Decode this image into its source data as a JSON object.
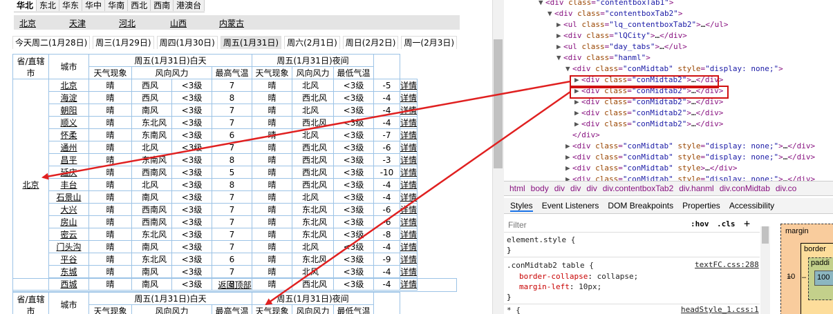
{
  "weather": {
    "region_tabs": [
      "华北",
      "东北",
      "华东",
      "华中",
      "华南",
      "西北",
      "西南",
      "港澳台"
    ],
    "provinces": [
      "北京",
      "天津",
      "河北",
      "山西",
      "内蒙古"
    ],
    "day_tabs": [
      "今天周二(1月28日)",
      "周三(1月29日)",
      "周四(1月30日)",
      "周五(1月31日)",
      "周六(2月1日)",
      "周日(2月2日)",
      "周一(2月3日)"
    ],
    "active_day": 3,
    "header": {
      "prov_col": "省/直辖市",
      "prov_col_line1": "省/直辖",
      "prov_col_line2": "市",
      "city_col": "城市",
      "day_group": "周五(1月31日)白天",
      "night_group": "周五(1月31日)夜间",
      "weather": "天气现象",
      "wind": "风向风力",
      "high": "最高气温",
      "low": "最低气温"
    },
    "province_name": "北京",
    "rows": [
      {
        "city": "北京",
        "dw": "晴",
        "dwd": "西风",
        "dwf": "<3级",
        "hi": "7",
        "nw": "晴",
        "nwd": "北风",
        "nwf": "<3级",
        "lo": "-5",
        "link": "详情"
      },
      {
        "city": "海淀",
        "dw": "晴",
        "dwd": "西风",
        "dwf": "<3级",
        "hi": "8",
        "nw": "晴",
        "nwd": "西北风",
        "nwf": "<3级",
        "lo": "-4",
        "link": "详情"
      },
      {
        "city": "朝阳",
        "dw": "晴",
        "dwd": "南风",
        "dwf": "<3级",
        "hi": "7",
        "nw": "晴",
        "nwd": "北风",
        "nwf": "<3级",
        "lo": "-4",
        "link": "详情"
      },
      {
        "city": "顺义",
        "dw": "晴",
        "dwd": "东北风",
        "dwf": "<3级",
        "hi": "7",
        "nw": "晴",
        "nwd": "西北风",
        "nwf": "<3级",
        "lo": "-4",
        "link": "详情"
      },
      {
        "city": "怀柔",
        "dw": "晴",
        "dwd": "东南风",
        "dwf": "<3级",
        "hi": "6",
        "nw": "晴",
        "nwd": "北风",
        "nwf": "<3级",
        "lo": "-7",
        "link": "详情"
      },
      {
        "city": "通州",
        "dw": "晴",
        "dwd": "北风",
        "dwf": "<3级",
        "hi": "7",
        "nw": "晴",
        "nwd": "西北风",
        "nwf": "<3级",
        "lo": "-6",
        "link": "详情"
      },
      {
        "city": "昌平",
        "dw": "晴",
        "dwd": "东南风",
        "dwf": "<3级",
        "hi": "8",
        "nw": "晴",
        "nwd": "西北风",
        "nwf": "<3级",
        "lo": "-3",
        "link": "详情"
      },
      {
        "city": "延庆",
        "dw": "晴",
        "dwd": "西南风",
        "dwf": "<3级",
        "hi": "5",
        "nw": "晴",
        "nwd": "西北风",
        "nwf": "<3级",
        "lo": "-10",
        "link": "详情"
      },
      {
        "city": "丰台",
        "dw": "晴",
        "dwd": "北风",
        "dwf": "<3级",
        "hi": "8",
        "nw": "晴",
        "nwd": "西北风",
        "nwf": "<3级",
        "lo": "-4",
        "link": "详情"
      },
      {
        "city": "石景山",
        "dw": "晴",
        "dwd": "南风",
        "dwf": "<3级",
        "hi": "7",
        "nw": "晴",
        "nwd": "北风",
        "nwf": "<3级",
        "lo": "-4",
        "link": "详情"
      },
      {
        "city": "大兴",
        "dw": "晴",
        "dwd": "西南风",
        "dwf": "<3级",
        "hi": "7",
        "nw": "晴",
        "nwd": "东北风",
        "nwf": "<3级",
        "lo": "-6",
        "link": "详情"
      },
      {
        "city": "房山",
        "dw": "晴",
        "dwd": "西南风",
        "dwf": "<3级",
        "hi": "7",
        "nw": "晴",
        "nwd": "东北风",
        "nwf": "<3级",
        "lo": "-6",
        "link": "详情"
      },
      {
        "city": "密云",
        "dw": "晴",
        "dwd": "东北风",
        "dwf": "<3级",
        "hi": "7",
        "nw": "晴",
        "nwd": "东北风",
        "nwf": "<3级",
        "lo": "-8",
        "link": "详情"
      },
      {
        "city": "门头沟",
        "dw": "晴",
        "dwd": "南风",
        "dwf": "<3级",
        "hi": "7",
        "nw": "晴",
        "nwd": "北风",
        "nwf": "<3级",
        "lo": "-4",
        "link": "详情"
      },
      {
        "city": "平谷",
        "dw": "晴",
        "dwd": "东北风",
        "dwf": "<3级",
        "hi": "6",
        "nw": "晴",
        "nwd": "东北风",
        "nwf": "<3级",
        "lo": "-9",
        "link": "详情"
      },
      {
        "city": "东城",
        "dw": "晴",
        "dwd": "南风",
        "dwf": "<3级",
        "hi": "7",
        "nw": "晴",
        "nwd": "北风",
        "nwf": "<3级",
        "lo": "-4",
        "link": "详情"
      },
      {
        "city": "西城",
        "dw": "晴",
        "dwd": "南风",
        "dwf": "<3级",
        "hi": "8",
        "nw": "晴",
        "nwd": "西北风",
        "nwf": "<3级",
        "lo": "-4",
        "link": "详情"
      }
    ],
    "back_to_top": "返回顶部"
  },
  "devtools": {
    "dom_lines": [
      {
        "indent": 0,
        "tri": "▼",
        "text": "<div class=\"contentboxTab1\">"
      },
      {
        "indent": 1,
        "tri": "▼",
        "text": "<div class=\"contentboxTab2\">"
      },
      {
        "indent": 2,
        "tri": "▶",
        "text": "<ul class=\"lq_contentboxTab2\">…</ul>"
      },
      {
        "indent": 2,
        "tri": "▶",
        "text": "<div class=\"lQCity\">…</div>"
      },
      {
        "indent": 2,
        "tri": "▶",
        "text": "<ul class=\"day_tabs\">…</ul>"
      },
      {
        "indent": 2,
        "tri": "▼",
        "text": "<div class=\"hanml\">"
      },
      {
        "indent": 3,
        "tri": "▼",
        "text": "<div class=\"conMidtab\" style=\"display: none;\">"
      },
      {
        "indent": 4,
        "tri": "▶",
        "text": "<div class=\"conMidtab2\">…</div>"
      },
      {
        "indent": 4,
        "tri": "▶",
        "text": "<div class=\"conMidtab2\">…</div>"
      },
      {
        "indent": 4,
        "tri": "▶",
        "text": "<div class=\"conMidtab2\">…</div>"
      },
      {
        "indent": 4,
        "tri": "▶",
        "text": "<div class=\"conMidtab2\">…</div>"
      },
      {
        "indent": 4,
        "tri": "▶",
        "text": "<div class=\"conMidtab2\">…</div>"
      },
      {
        "indent": 3,
        "tri": "",
        "text": "</div>"
      },
      {
        "indent": 3,
        "tri": "▶",
        "text": "<div class=\"conMidtab\" style=\"display: none;\">…</div>"
      },
      {
        "indent": 3,
        "tri": "▶",
        "text": "<div class=\"conMidtab\" style=\"display: none;\">…</div>"
      },
      {
        "indent": 3,
        "tri": "▶",
        "text": "<div class=\"conMidtab\" style>…</div>"
      },
      {
        "indent": 3,
        "tri": "▶",
        "text": "<div class=\"conMidtab\" style=\"display: none;\">…</div>"
      }
    ],
    "breadcrumbs": [
      "html",
      "body",
      "div",
      "div",
      "div",
      "div.contentboxTab2",
      "div.hanml",
      "div.conMidtab",
      "div.co"
    ],
    "panel_tabs": [
      "Styles",
      "Event Listeners",
      "DOM Breakpoints",
      "Properties",
      "Accessibility"
    ],
    "filter_placeholder": "Filter",
    "hov_label": ":hov",
    "cls_label": ".cls",
    "plus_label": "+",
    "rules": {
      "element_style": "element.style {",
      "close": "}",
      "rule2_selector": ".conMidtab2 table {",
      "rule2_source": "textFC.css:288",
      "rule2_prop1": "border-collapse",
      "rule2_val1": "collapse;",
      "rule2_prop2": "margin-left",
      "rule2_val2": "10px;",
      "rule3_selector": "* {",
      "rule3_source": "headStyle_1.css:1"
    },
    "boxmodel": {
      "margin_label": "margin",
      "border_label": "border",
      "padding_label": "paddi",
      "left_value": "10",
      "dash": "–",
      "content_value": "100"
    }
  },
  "colors": {
    "arrow": "#e02020",
    "highlight_box": "#d01010",
    "table_border": "#9cc3e6",
    "tag": "#881280",
    "attr_name": "#994500",
    "attr_value": "#1a1aa6",
    "margin_box": "#f9cc9d",
    "border_box": "#fddd9b",
    "padding_box": "#c3d08b",
    "content_box": "#8cb6c0"
  }
}
